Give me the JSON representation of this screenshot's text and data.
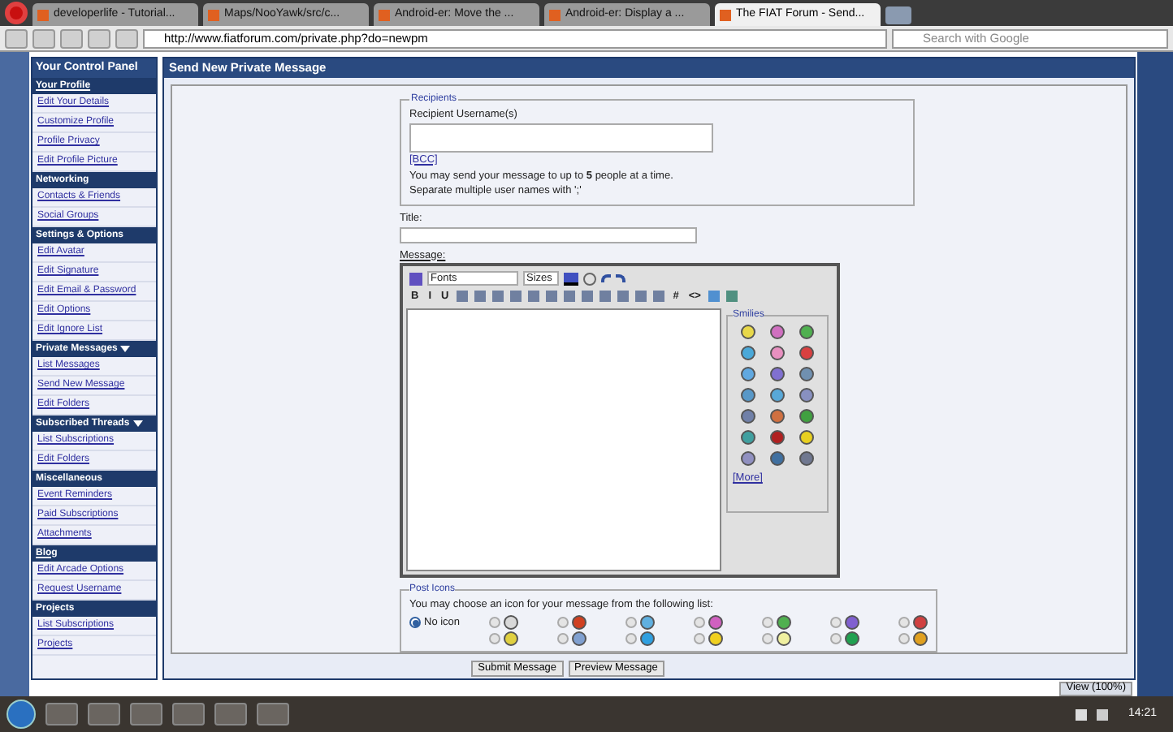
{
  "browser": {
    "tabs": [
      {
        "label": "developerlife - Tutorial...",
        "selected": false
      },
      {
        "label": "Maps/NooYawk/src/c...",
        "selected": false
      },
      {
        "label": "Android-er: Move the ...",
        "selected": false
      },
      {
        "label": "Android-er: Display a ...",
        "selected": false
      },
      {
        "label": "The FIAT Forum - Send...",
        "selected": true
      }
    ],
    "url": "http://www.fiatforum.com/private.php?do=newpm",
    "search_placeholder": "Search with Google"
  },
  "sidebar": {
    "title": "Your Control Panel",
    "sections": [
      {
        "title": "Your Profile",
        "link": true,
        "collapsible": false,
        "items": [
          "Edit Your Details",
          "Customize Profile",
          "Profile Privacy",
          "Edit Profile Picture"
        ]
      },
      {
        "title": "Networking",
        "link": false,
        "collapsible": false,
        "items": [
          "Contacts & Friends",
          "Social Groups"
        ]
      },
      {
        "title": "Settings & Options",
        "link": false,
        "collapsible": false,
        "items": [
          "Edit Avatar",
          "Edit Signature",
          "Edit Email & Password",
          "Edit Options",
          "Edit Ignore List"
        ]
      },
      {
        "title": "Private Messages",
        "link": false,
        "collapsible": true,
        "items": [
          "List Messages",
          "Send New Message",
          "Edit Folders"
        ]
      },
      {
        "title": "Subscribed Threads",
        "link": false,
        "collapsible": true,
        "items": [
          "List Subscriptions",
          "Edit Folders"
        ]
      },
      {
        "title": "Miscellaneous",
        "link": false,
        "collapsible": false,
        "items": [
          "Event Reminders",
          "Paid Subscriptions",
          "Attachments"
        ]
      },
      {
        "title": "Blog",
        "link": true,
        "collapsible": false,
        "items": [
          "Edit Arcade Options",
          "Request Username"
        ]
      },
      {
        "title": "Projects",
        "link": false,
        "collapsible": false,
        "items": [
          "List Subscriptions",
          "Projects"
        ]
      }
    ]
  },
  "main": {
    "title": "Send New Private Message",
    "recipients": {
      "legend": "Recipients",
      "label": "Recipient Username(s)",
      "bcc": "[BCC]",
      "note": "You may send your message to up to **5** people at a time.",
      "note_2": "Separate multiple user names with ';'"
    },
    "title_label": "Title:",
    "message_label": "Message:",
    "editor": {
      "font_select": "Fonts",
      "size_select": "Sizes",
      "format_buttons": [
        "B",
        "I",
        "U"
      ],
      "code_buttons": [
        "#",
        "<>"
      ],
      "smilies": {
        "legend": "Smilies",
        "more": "[More]",
        "items": [
          {
            "color": "#e8d84a"
          },
          {
            "color": "#d070c0"
          },
          {
            "color": "#50b050"
          },
          {
            "color": "#4aa8d8"
          },
          {
            "color": "#e890c0"
          },
          {
            "color": "#d84040"
          },
          {
            "color": "#60a8e0"
          },
          {
            "color": "#8070d0"
          },
          {
            "color": "#7090b0"
          },
          {
            "color": "#5898c8"
          },
          {
            "color": "#58a8d8"
          },
          {
            "color": "#8890c0"
          },
          {
            "color": "#7080a8"
          },
          {
            "color": "#d07040"
          },
          {
            "color": "#40a040"
          },
          {
            "color": "#40a0a0"
          },
          {
            "color": "#b02020"
          },
          {
            "color": "#e8d020"
          },
          {
            "color": "#9090c0"
          },
          {
            "color": "#4070a0"
          },
          {
            "color": "#707890"
          }
        ]
      }
    },
    "post_icons": {
      "legend": "Post Icons",
      "prompt": "You may choose an icon for your message from the following list:",
      "no_icon": {
        "label": "No icon",
        "selected": true
      },
      "icons": [
        {
          "color": "#d8d8d8",
          "selected": false
        },
        {
          "color": "#e0d040",
          "selected": false
        },
        {
          "color": "#d04020",
          "selected": false
        },
        {
          "color": "#80a0d0",
          "selected": false
        },
        {
          "color": "#60b0e0",
          "selected": false
        },
        {
          "color": "#30a0e0",
          "selected": false
        },
        {
          "color": "#d060c0",
          "selected": false
        },
        {
          "color": "#f0d020",
          "selected": false
        },
        {
          "color": "#50b050",
          "selected": false
        },
        {
          "color": "#f0f0a0",
          "selected": false
        },
        {
          "color": "#8060d0",
          "selected": false
        },
        {
          "color": "#20a050",
          "selected": false
        },
        {
          "color": "#d04040",
          "selected": false
        },
        {
          "color": "#e0a020",
          "selected": false
        }
      ]
    },
    "buttons": [
      "Submit Message",
      "Preview Message"
    ]
  },
  "status": {
    "zoom": "View (100%)"
  },
  "taskbar": {
    "time": "14:21"
  }
}
